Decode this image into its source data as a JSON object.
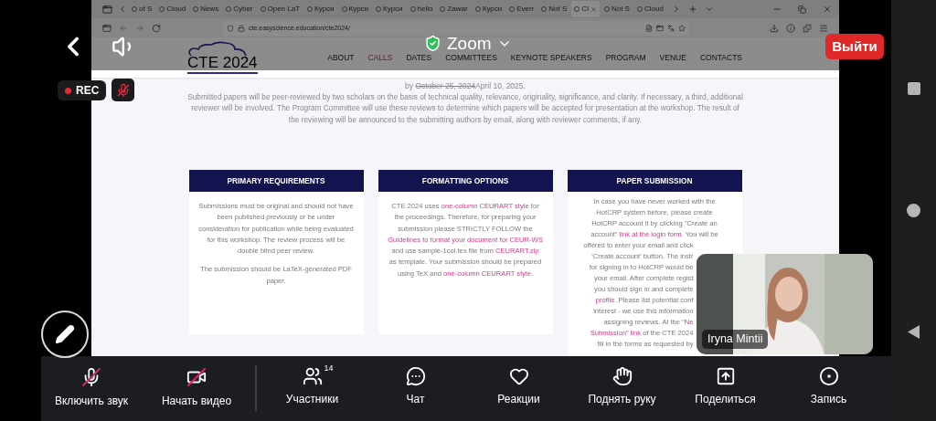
{
  "zoom_bar": {
    "title": "Zoom",
    "leave_button": "Выйти"
  },
  "recording_badge": "REC",
  "browser": {
    "tabs": [
      {
        "label": "ot S",
        "selected": false
      },
      {
        "label": "Cloud",
        "selected": false
      },
      {
        "label": "News",
        "selected": false
      },
      {
        "label": "Cyber",
        "selected": false
      },
      {
        "label": "Open LaT",
        "selected": false
      },
      {
        "label": "Курси",
        "selected": false
      },
      {
        "label": "Курси",
        "selected": false
      },
      {
        "label": "Курси",
        "selected": false
      },
      {
        "label": "hello",
        "selected": false
      },
      {
        "label": "Zawar",
        "selected": false
      },
      {
        "label": "Курси",
        "selected": false
      },
      {
        "label": "Everr",
        "selected": false
      },
      {
        "label": "Not S",
        "selected": false
      },
      {
        "label": "Cl",
        "selected": true
      },
      {
        "label": "Not S",
        "selected": false
      },
      {
        "label": "Cloud",
        "selected": false
      }
    ],
    "address": "cte.easyscience.education/cte2024/"
  },
  "site": {
    "logo": "CTE 2024",
    "nav": [
      {
        "label": "ABOUT",
        "selected": false
      },
      {
        "label": "CALLS",
        "selected": true
      },
      {
        "label": "DATES",
        "selected": false
      },
      {
        "label": "COMMITTEES",
        "selected": false
      },
      {
        "label": "KEYNOTE SPEAKERS",
        "selected": false
      },
      {
        "label": "PROGRAM",
        "selected": false
      },
      {
        "label": "VENUE",
        "selected": false
      },
      {
        "label": "CONTACTS",
        "selected": false
      }
    ],
    "deadline": [
      {
        "text": "by "
      },
      {
        "text": "October 25, 2024",
        "struck": true
      },
      {
        "text": "April 10, 2025."
      }
    ],
    "review_text": "Submitted papers will be peer-reviewed by two scholars on the basis of technical quality, relevance, originality, significance, and clarity. If necessary, a third, additional reviewer will be involved. The Program Committee will use these reviews to determine which papers will be accepted for presentation at the workshop. The result of the reviewing will be announced to the submitting authors by email, along with reviewer comments, if any.",
    "cards": [
      {
        "title": "PRIMARY REQUIREMENTS",
        "kind": "paragraphs",
        "paragraphs": [
          [
            {
              "text": "Submissions must be original and should not have been published previously or be under consideration for publication while being evaluated for this workshop. The review process will be double blind peer review."
            }
          ],
          [
            {
              "text": "The submission should be LaTeX-generated PDF paper."
            }
          ]
        ]
      },
      {
        "title": "FORMATTING OPTIONS",
        "kind": "paragraphs",
        "paragraphs": [
          [
            {
              "text": "CTE 2024 uses "
            },
            {
              "text": "one-column CEURART style",
              "link": true
            },
            {
              "text": " for the proceedings. Therefore, for preparing your submission please STRICTLY FOLLOW the "
            },
            {
              "text": "Guidelines to format your document for CEUR-WS",
              "link": true
            },
            {
              "text": " and use sample-1col.tex file from "
            },
            {
              "text": "CEURART.zip",
              "link": true
            },
            {
              "text": " as template. Your submission should be prepared using TeX and "
            },
            {
              "text": "one-column CEURART style",
              "link": true
            },
            {
              "text": "."
            }
          ]
        ]
      },
      {
        "title": "PAPER SUBMISSION",
        "kind": "lines",
        "lines": [
          {
            "covered": false,
            "segments": [
              {
                "text": "In case you have never worked with the"
              }
            ]
          },
          {
            "covered": false,
            "segments": [
              {
                "text": "HotCRP system before, please create"
              }
            ]
          },
          {
            "covered": false,
            "segments": [
              {
                "text": "HotCRP account it by clicking \"Create an"
              }
            ]
          },
          {
            "covered": false,
            "segments": [
              {
                "text": "account\" "
              },
              {
                "text": "link at the login form",
                "link": true
              },
              {
                "text": ". You will be"
              }
            ]
          },
          {
            "covered": true,
            "segments": [
              {
                "text": "offered to enter your email and click"
              }
            ]
          },
          {
            "covered": true,
            "segments": [
              {
                "text": "'Create account' button. The instr"
              }
            ]
          },
          {
            "covered": true,
            "segments": [
              {
                "text": "for signing in to HotCRP would be"
              }
            ]
          },
          {
            "covered": true,
            "segments": [
              {
                "text": "your email. After complete regist"
              }
            ]
          },
          {
            "covered": true,
            "segments": [
              {
                "text": "you should sign in and complete"
              }
            ]
          },
          {
            "covered": true,
            "segments": [
              {
                "text": "profile",
                "link": true
              },
              {
                "text": ". Please list potential conf"
              }
            ]
          },
          {
            "covered": true,
            "segments": [
              {
                "text": "interest - we use this information"
              }
            ]
          },
          {
            "covered": true,
            "segments": [
              {
                "text": "assigning reviews. At the \""
              },
              {
                "text": "Ne",
                "link": true
              }
            ]
          },
          {
            "covered": true,
            "segments": [
              {
                "text": "Submission\" link",
                "link": true
              },
              {
                "text": " of the CTE 2024"
              }
            ]
          },
          {
            "covered": true,
            "segments": [
              {
                "text": "fill in the forms as requested by"
              }
            ]
          }
        ]
      }
    ]
  },
  "video_tile": {
    "name": "Iryna Mintii"
  },
  "toolbar": [
    {
      "kind": "mic-off",
      "label": "Включить звук"
    },
    {
      "kind": "video-off",
      "label": "Начать видео"
    },
    {
      "kind": "participants",
      "label": "Участники",
      "badge": "14"
    },
    {
      "kind": "chat",
      "label": "Чат"
    },
    {
      "kind": "reactions",
      "label": "Реакции"
    },
    {
      "kind": "raise-hand",
      "label": "Поднять руку"
    },
    {
      "kind": "share",
      "label": "Поделиться"
    },
    {
      "kind": "record",
      "label": "Запись"
    }
  ]
}
